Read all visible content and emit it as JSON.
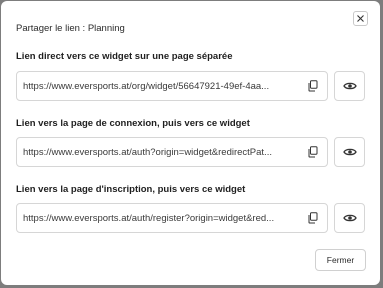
{
  "dialog": {
    "title": "Partager le lien : Planning",
    "close_icon": "close-icon"
  },
  "links": [
    {
      "label": "Lien direct vers ce widget sur une page séparée",
      "url": "https://www.eversports.at/org/widget/56647921-49ef-4aa...",
      "copy_icon": "copy-icon",
      "preview_icon": "eye-icon"
    },
    {
      "label": "Lien vers la page de connexion, puis vers ce widget",
      "url": "https://www.eversports.at/auth?origin=widget&redirectPat...",
      "copy_icon": "copy-icon",
      "preview_icon": "eye-icon"
    },
    {
      "label": "Lien vers la page d'inscription, puis vers ce widget",
      "url": "https://www.eversports.at/auth/register?origin=widget&red...",
      "copy_icon": "copy-icon",
      "preview_icon": "eye-icon"
    }
  ],
  "footer": {
    "close_label": "Fermer"
  }
}
